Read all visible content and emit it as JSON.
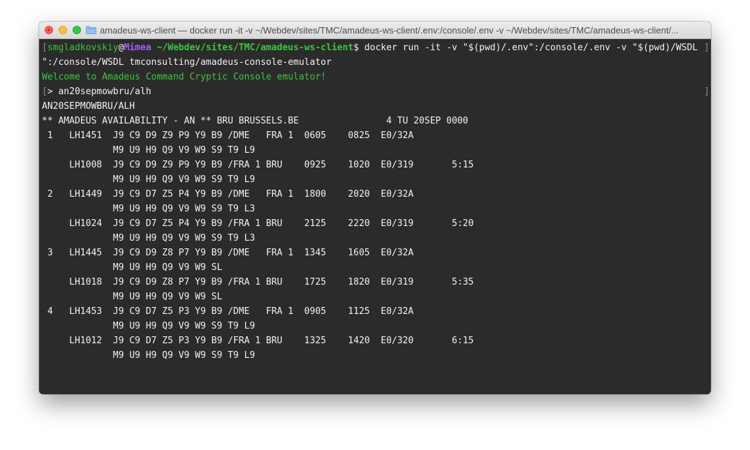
{
  "window": {
    "title": "amadeus-ws-client — docker run -it -v ~/Webdev/sites/TMC/amadeus-ws-client/.env:/console/.env -v ~/Webdev/sites/TMC/amadeus-ws-client/..."
  },
  "prompt": {
    "user": "smgladkovskiy",
    "at": "@",
    "host": "Mimea",
    "sep": " ",
    "path": "~/Webdev/sites/TMC/amadeus-ws-client",
    "dollar": "$",
    "command_part1": " docker run -it -v \"$(pwd)/.env\":/console/.env -v \"$(pwd)/WSDL",
    "command_part2": "\":/console/WSDL tmconsulting/amadeus-console-emulator"
  },
  "welcome": "Welcome to Amadeus Command Cryptic Console emulator!",
  "input_line": {
    "prefix": "> ",
    "command": "an20sepmowbru/alh"
  },
  "output": {
    "echo": "AN20SEPMOWBRU/ALH",
    "header": "** AMADEUS AVAILABILITY - AN ** BRU BRUSSELS.BE                4 TU 20SEP 0000",
    "rows": [
      " 1   LH1451  J9 C9 D9 Z9 P9 Y9 B9 /DME   FRA 1  0605    0825  E0/32A",
      "             M9 U9 H9 Q9 V9 W9 S9 T9 L9",
      "     LH1008  J9 C9 D9 Z9 P9 Y9 B9 /FRA 1 BRU    0925    1020  E0/319       5:15",
      "             M9 U9 H9 Q9 V9 W9 S9 T9 L9",
      " 2   LH1449  J9 C9 D7 Z5 P4 Y9 B9 /DME   FRA 1  1800    2020  E0/32A",
      "             M9 U9 H9 Q9 V9 W9 S9 T9 L3",
      "     LH1024  J9 C9 D7 Z5 P4 Y9 B9 /FRA 1 BRU    2125    2220  E0/319       5:20",
      "             M9 U9 H9 Q9 V9 W9 S9 T9 L3",
      " 3   LH1445  J9 C9 D9 Z8 P7 Y9 B9 /DME   FRA 1  1345    1605  E0/32A",
      "             M9 U9 H9 Q9 V9 W9 SL",
      "     LH1018  J9 C9 D9 Z8 P7 Y9 B9 /FRA 1 BRU    1725    1820  E0/319       5:35",
      "             M9 U9 H9 Q9 V9 W9 SL",
      " 4   LH1453  J9 C9 D7 Z5 P3 Y9 B9 /DME   FRA 1  0905    1125  E0/32A",
      "             M9 U9 H9 Q9 V9 W9 S9 T9 L9",
      "     LH1012  J9 C9 D7 Z5 P3 Y9 B9 /FRA 1 BRU    1325    1420  E0/320       6:15",
      "             M9 U9 H9 Q9 V9 W9 S9 T9 L9"
    ]
  },
  "final_prompt": ">",
  "icons": {
    "close": "close-icon",
    "minimize": "minimize-icon",
    "maximize": "maximize-icon",
    "folder": "folder-icon"
  },
  "colors": {
    "terminal_bg": "#2b2b2b",
    "text": "#f2f2f2",
    "prompt_green": "#3ec43e",
    "host_purple": "#a060ff"
  }
}
